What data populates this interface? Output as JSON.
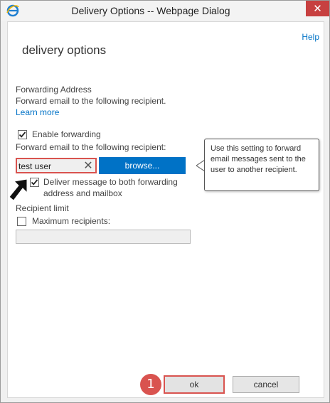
{
  "window": {
    "title": "Delivery Options -- Webpage Dialog",
    "close_glyph": "✕",
    "icon": "ie-icon"
  },
  "dialog": {
    "help_label": "Help",
    "page_title": "delivery options",
    "section_label": "Forwarding Address",
    "section_desc": "Forward email to the following recipient.",
    "learn_more": "Learn more"
  },
  "forwarding": {
    "enable_label": "Enable forwarding",
    "enable_checked": true,
    "recipient_prompt": "Forward email to the following recipient:",
    "recipient_value": "test user",
    "clear_glyph": "✕",
    "browse_label": "browse...",
    "deliver_both_label_1": "Deliver message to both forwarding",
    "deliver_both_label_2": "address and mailbox",
    "deliver_both_checked": true,
    "tooltip": "Use this setting to forward email messages sent to the user to another recipient."
  },
  "recipient_limit": {
    "label": "Recipient limit",
    "max_label": "Maximum recipients:",
    "max_checked": false,
    "max_value": ""
  },
  "footer": {
    "ok_label": "ok",
    "cancel_label": "cancel",
    "step_number": "1"
  },
  "colors": {
    "accent": "#0072c6",
    "highlight": "#d9534f",
    "close": "#c74040"
  }
}
